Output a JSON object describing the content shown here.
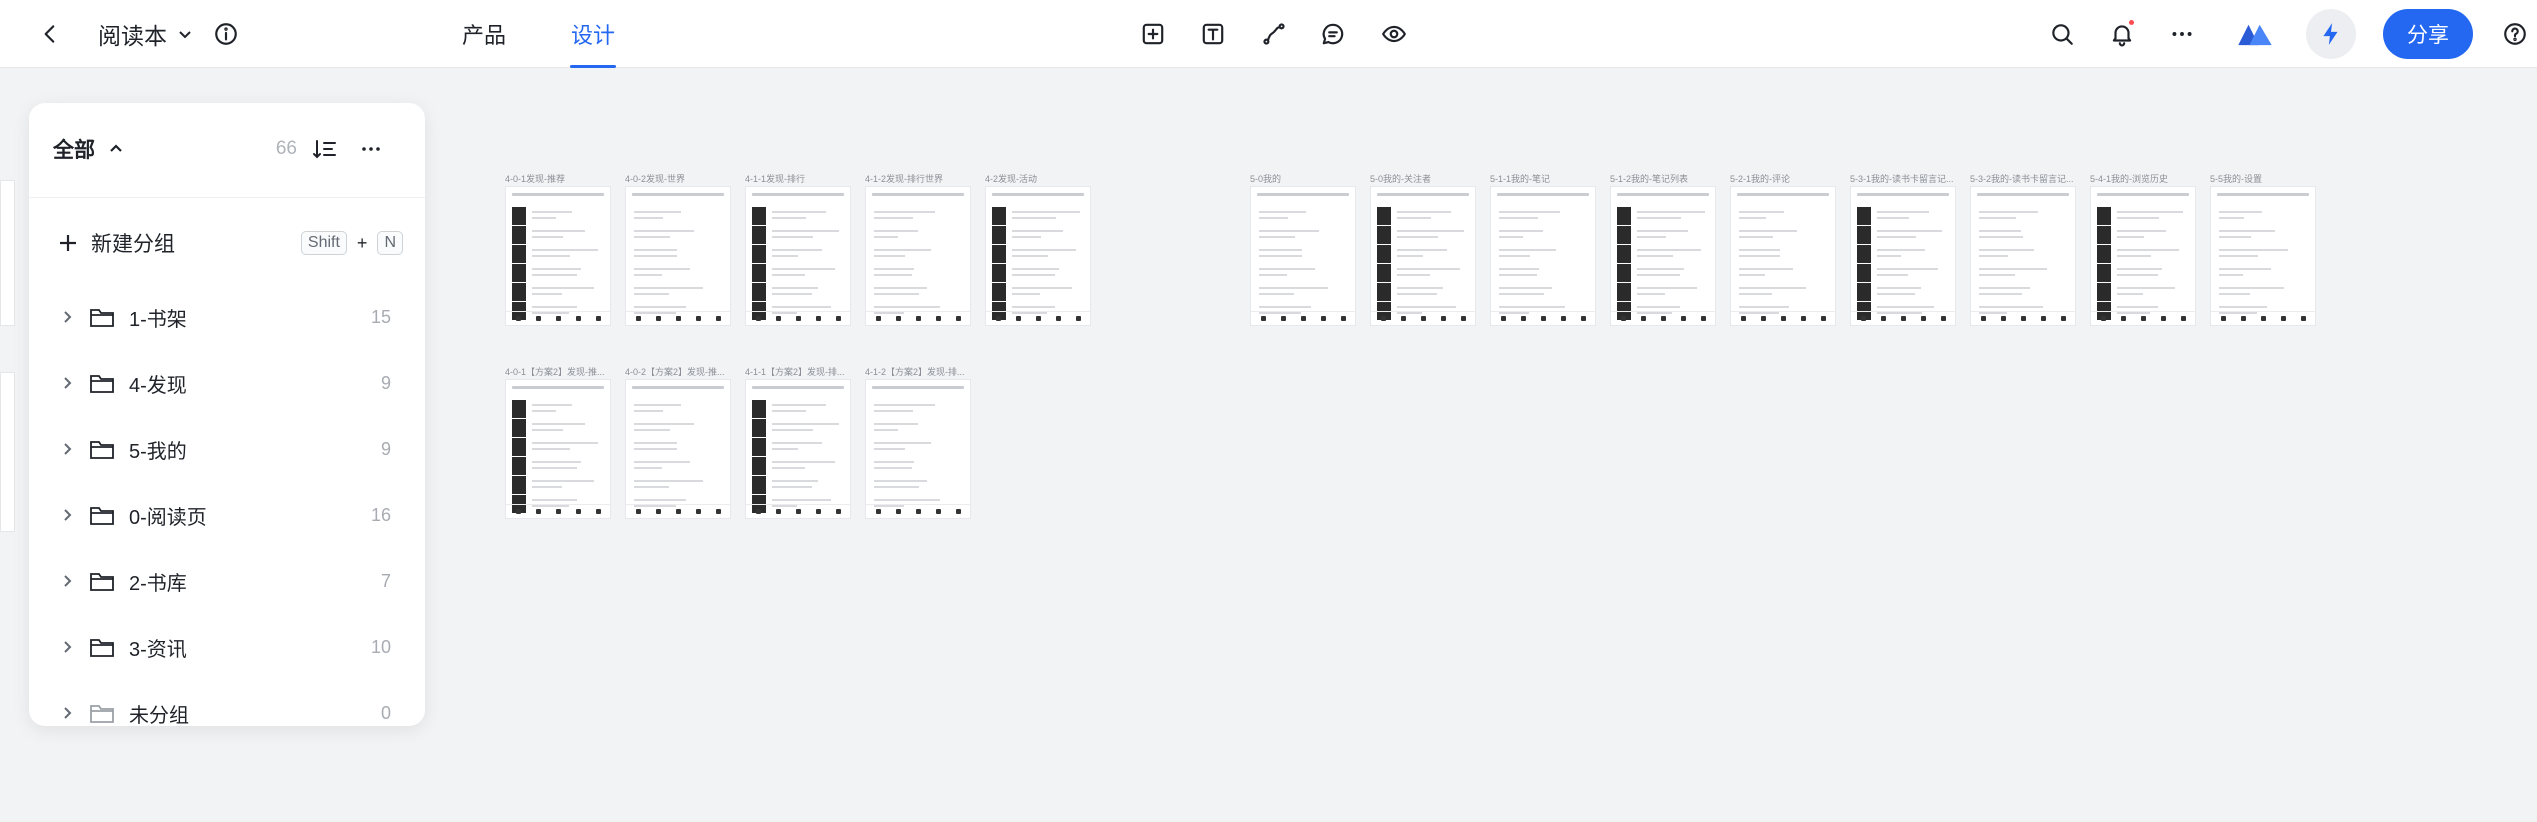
{
  "header": {
    "project_title": "阅读本",
    "tabs": [
      {
        "label": "产品",
        "active": false
      },
      {
        "label": "设计",
        "active": true
      }
    ],
    "share_label": "分享",
    "tools": [
      "add-frame-icon",
      "text-icon",
      "path-icon",
      "comment-icon",
      "preview-icon"
    ],
    "right_icons": [
      "search-icon",
      "bell-icon",
      "more-icon",
      "logo-icon",
      "bolt-icon",
      "help-icon"
    ]
  },
  "colors": {
    "accent": "#2468f2",
    "notification": "#ff4d4f",
    "canvas_bg": "#f2f3f5"
  },
  "panel": {
    "title": "全部",
    "total_count": "66",
    "new_group_label": "新建分组",
    "shortcut_key1": "Shift",
    "shortcut_plus": "+",
    "shortcut_key2": "N",
    "groups": [
      {
        "name": "1-书架",
        "count": "15"
      },
      {
        "name": "4-发现",
        "count": "9"
      },
      {
        "name": "5-我的",
        "count": "9"
      },
      {
        "name": "0-阅读页",
        "count": "16"
      },
      {
        "name": "2-书库",
        "count": "7"
      },
      {
        "name": "3-资讯",
        "count": "10"
      },
      {
        "name": "未分组",
        "count": "0"
      }
    ]
  },
  "canvas": {
    "row1_group1": [
      "4-0-1发现-推荐",
      "4-0-2发现-世界",
      "4-1-1发现-排行",
      "4-1-2发现-排行世界",
      "4-2发现-活动"
    ],
    "row1_group2": [
      "5-0我的",
      "5-0我的-关注者",
      "5-1-1我的-笔记",
      "5-1-2我的-笔记列表",
      "5-2-1我的-评论",
      "5-3-1我的-读书卡留言记...",
      "5-3-2我的-读书卡留言记...",
      "5-4-1我的-浏览历史",
      "5-5我的-设置"
    ],
    "row2": [
      "4-0-1【方案2】发现-推...",
      "4-0-2【方案2】发现-推...",
      "4-1-1【方案2】发现-排...",
      "4-1-2【方案2】发现-排..."
    ]
  }
}
